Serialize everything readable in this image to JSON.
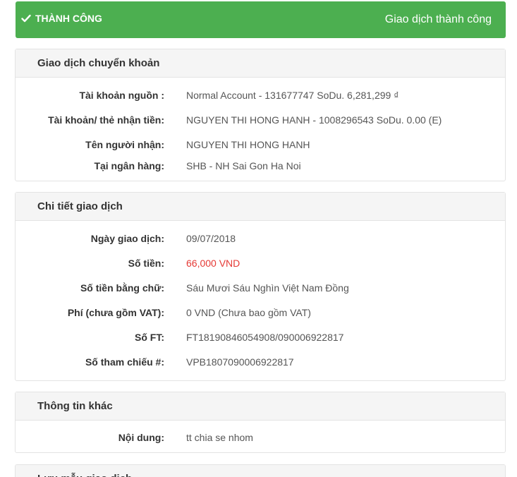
{
  "status": {
    "label": "THÀNH CÔNG",
    "message": "Giao dịch thành công",
    "color": "#4caf50"
  },
  "transfer": {
    "title": "Giao dịch chuyển khoản",
    "rows": [
      {
        "label": "Tài khoản nguồn :",
        "value": "Normal Account - 131677747 SoDu. 6,281,299 ₫"
      },
      {
        "label": "Tài khoản/ thẻ nhận tiền:",
        "value": "NGUYEN THI HONG HANH - 1008296543 SoDu. 0.00 (E)"
      },
      {
        "label": "Tên người nhận:",
        "value": "NGUYEN THI HONG HANH"
      },
      {
        "label": "Tại ngân hàng:",
        "value": "SHB - NH Sai Gon Ha Noi"
      }
    ]
  },
  "details": {
    "title": "Chi tiết giao dịch",
    "rows": [
      {
        "label": "Ngày giao dịch:",
        "value": "09/07/2018"
      },
      {
        "label": "Số tiền:",
        "value": "66,000 VND"
      },
      {
        "label": "Số tiền bằng chữ:",
        "value": "Sáu Mươi Sáu Nghìn Việt Nam Đồng"
      },
      {
        "label": "Phí (chưa gồm VAT):",
        "value": "0 VND (Chưa bao gồm VAT)"
      },
      {
        "label": "Số FT:",
        "value": "FT18190846054908/090006922817"
      },
      {
        "label": "Số tham chiếu #:",
        "value": "VPB1807090006922817"
      }
    ]
  },
  "other": {
    "title": "Thông tin khác",
    "rows": [
      {
        "label": "Nội dung:",
        "value": "tt chia se nhom"
      }
    ]
  },
  "next_panel": {
    "title": "Lưu mẫu giao dịch"
  }
}
